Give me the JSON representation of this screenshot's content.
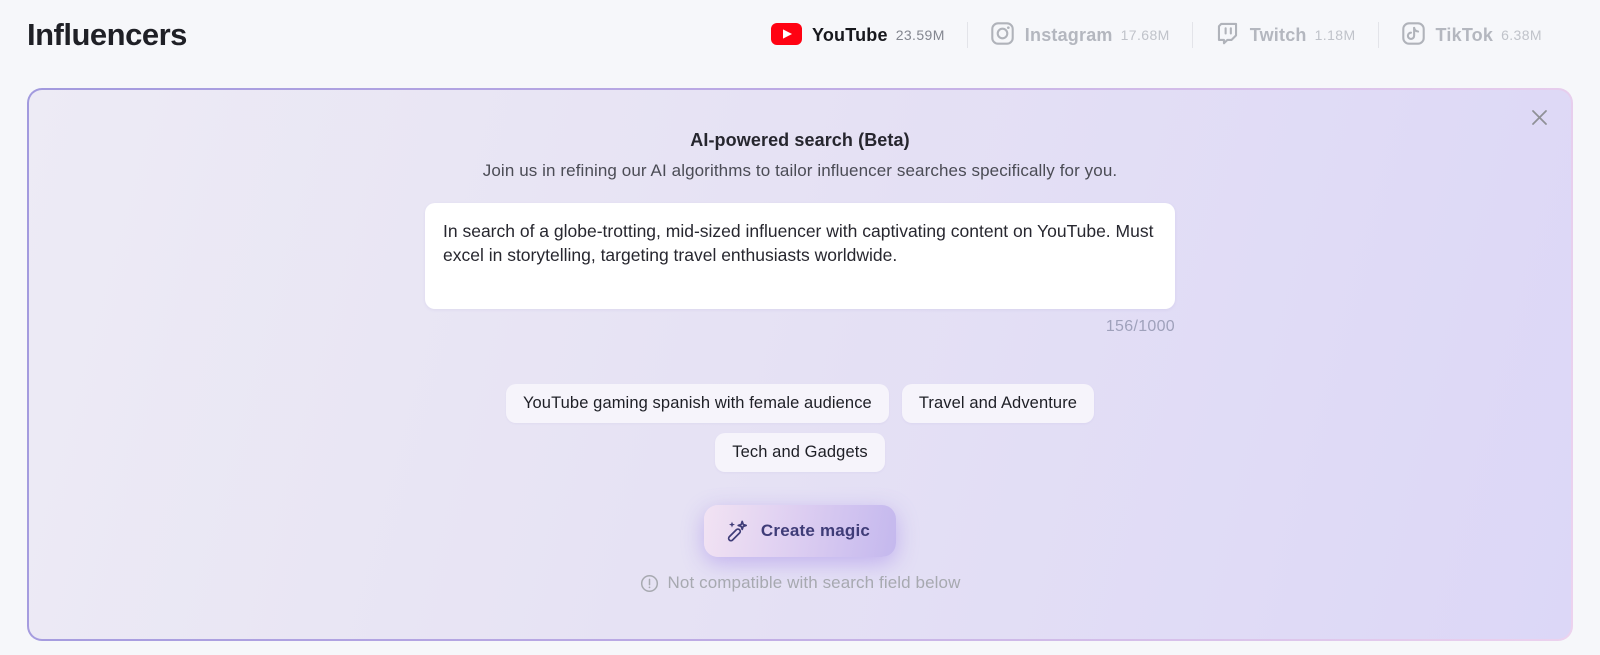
{
  "header": {
    "title": "Influencers",
    "platforms": [
      {
        "name": "YouTube",
        "count": "23.59M",
        "state": "active"
      },
      {
        "name": "Instagram",
        "count": "17.68M",
        "state": "inactive"
      },
      {
        "name": "Twitch",
        "count": "1.18M",
        "state": "inactive"
      },
      {
        "name": "TikTok",
        "count": "6.38M",
        "state": "inactive"
      }
    ]
  },
  "ai_panel": {
    "title": "AI-powered search (Beta)",
    "subtitle": "Join us in refining our AI algorithms to tailor influencer searches specifically for you.",
    "prompt_value": "In search of a globe-trotting, mid-sized influencer with captivating content on YouTube. Must excel in storytelling, targeting travel enthusiasts worldwide.",
    "char_counter": "156/1000",
    "suggestions": [
      "YouTube gaming spanish with female audience",
      "Travel and Adventure",
      "Tech and Gadgets"
    ],
    "submit_label": "Create magic",
    "note": "Not compatible with search field below"
  },
  "icons": {
    "youtube": "youtube-play-icon",
    "instagram": "instagram-camera-icon",
    "twitch": "twitch-glitch-icon",
    "tiktok": "tiktok-note-icon",
    "close": "close-icon",
    "magic": "magic-wand-icon",
    "note": "alert-circle-icon"
  },
  "colors": {
    "youtube_red": "#ff0212",
    "panel_border_left": "#a29ade",
    "panel_border_right": "#ecd2ee",
    "panel_bg_left": "#edebf5",
    "panel_bg_right": "#dcd7f7",
    "button_text": "#3f3c78",
    "inactive_gray": "#b4b7bf"
  }
}
